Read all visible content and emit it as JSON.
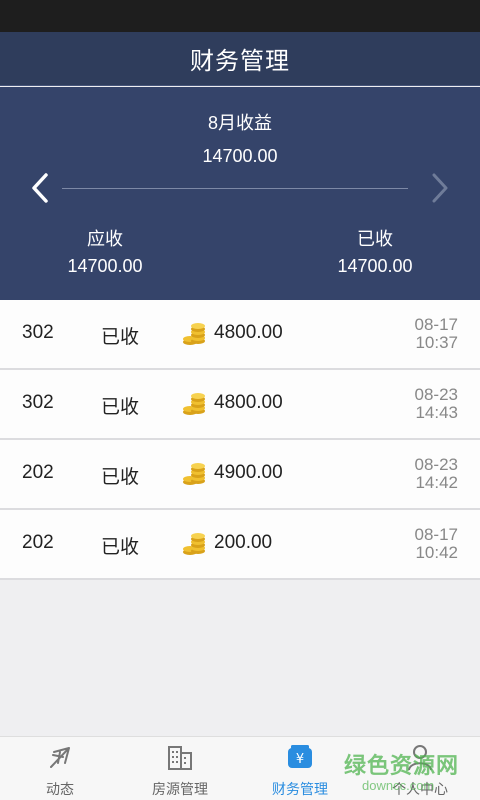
{
  "header": {
    "title": "财务管理"
  },
  "summary": {
    "month_label": "8月收益",
    "total": "14700.00",
    "receivable_label": "应收",
    "receivable_value": "14700.00",
    "received_label": "已收",
    "received_value": "14700.00"
  },
  "records": [
    {
      "room": "302",
      "status": "已收",
      "amount": "4800.00",
      "date": "08-17",
      "time": "10:37"
    },
    {
      "room": "302",
      "status": "已收",
      "amount": "4800.00",
      "date": "08-23",
      "time": "14:43"
    },
    {
      "room": "202",
      "status": "已收",
      "amount": "4900.00",
      "date": "08-23",
      "time": "14:42"
    },
    {
      "room": "202",
      "status": "已收",
      "amount": "200.00",
      "date": "08-17",
      "time": "10:42"
    }
  ],
  "tabs": [
    {
      "label": "动态",
      "icon": "plane-icon"
    },
    {
      "label": "房源管理",
      "icon": "building-icon"
    },
    {
      "label": "财务管理",
      "icon": "wallet-yen-icon",
      "active": true
    },
    {
      "label": "个人中心",
      "icon": "person-icon"
    }
  ],
  "watermark": {
    "cn": "绿色资源网",
    "en": "downcc.com"
  },
  "colors": {
    "header": "#2f3d5c",
    "summary": "#35446a",
    "active_tab": "#2a8de0",
    "coin": "#e0b020"
  }
}
